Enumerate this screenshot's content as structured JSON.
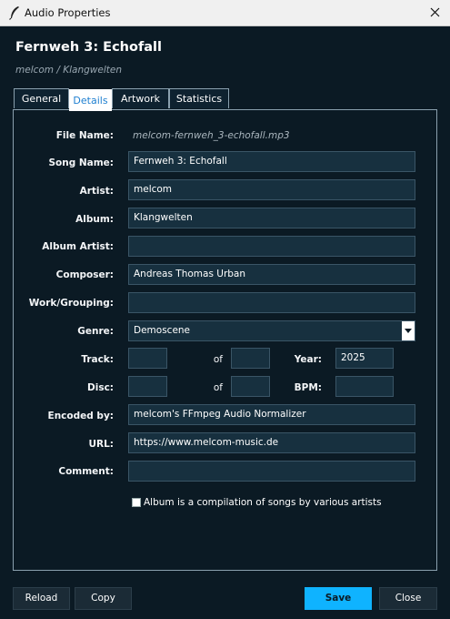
{
  "window": {
    "title": "Audio Properties",
    "icon": "feather-icon"
  },
  "header": {
    "title": "Fernweh 3: Echofall",
    "subtitle": "melcom / Klangwelten"
  },
  "tabs": [
    {
      "label": "General"
    },
    {
      "label": "Details",
      "active": true
    },
    {
      "label": "Artwork"
    },
    {
      "label": "Statistics"
    }
  ],
  "form": {
    "file_name": {
      "label": "File Name:",
      "value": "melcom-fernweh_3-echofall.mp3"
    },
    "song_name": {
      "label": "Song Name:",
      "value": "Fernweh 3: Echofall"
    },
    "artist": {
      "label": "Artist:",
      "value": "melcom"
    },
    "album": {
      "label": "Album:",
      "value": "Klangwelten"
    },
    "album_artist": {
      "label": "Album Artist:",
      "value": ""
    },
    "composer": {
      "label": "Composer:",
      "value": "Andreas Thomas Urban"
    },
    "work_grouping": {
      "label": "Work/Grouping:",
      "value": ""
    },
    "genre": {
      "label": "Genre:",
      "value": "Demoscene"
    },
    "track": {
      "label": "Track:",
      "value": "",
      "of_label": "of",
      "of_value": ""
    },
    "year": {
      "label": "Year:",
      "value": "2025"
    },
    "disc": {
      "label": "Disc:",
      "value": "",
      "of_label": "of",
      "of_value": ""
    },
    "bpm": {
      "label": "BPM:",
      "value": ""
    },
    "encoded_by": {
      "label": "Encoded by:",
      "value": "melcom's FFmpeg Audio Normalizer"
    },
    "url": {
      "label": "URL:",
      "value": "https://www.melcom-music.de"
    },
    "comment": {
      "label": "Comment:",
      "value": ""
    },
    "compilation": {
      "label": "Album is a compilation of songs by various artists",
      "checked": false
    }
  },
  "buttons": {
    "reload": "Reload",
    "copy": "Copy",
    "save": "Save",
    "close": "Close"
  },
  "colors": {
    "background": "#0b1a24",
    "accent": "#0fb3ff",
    "active_tab_text": "#1e7fd0"
  }
}
